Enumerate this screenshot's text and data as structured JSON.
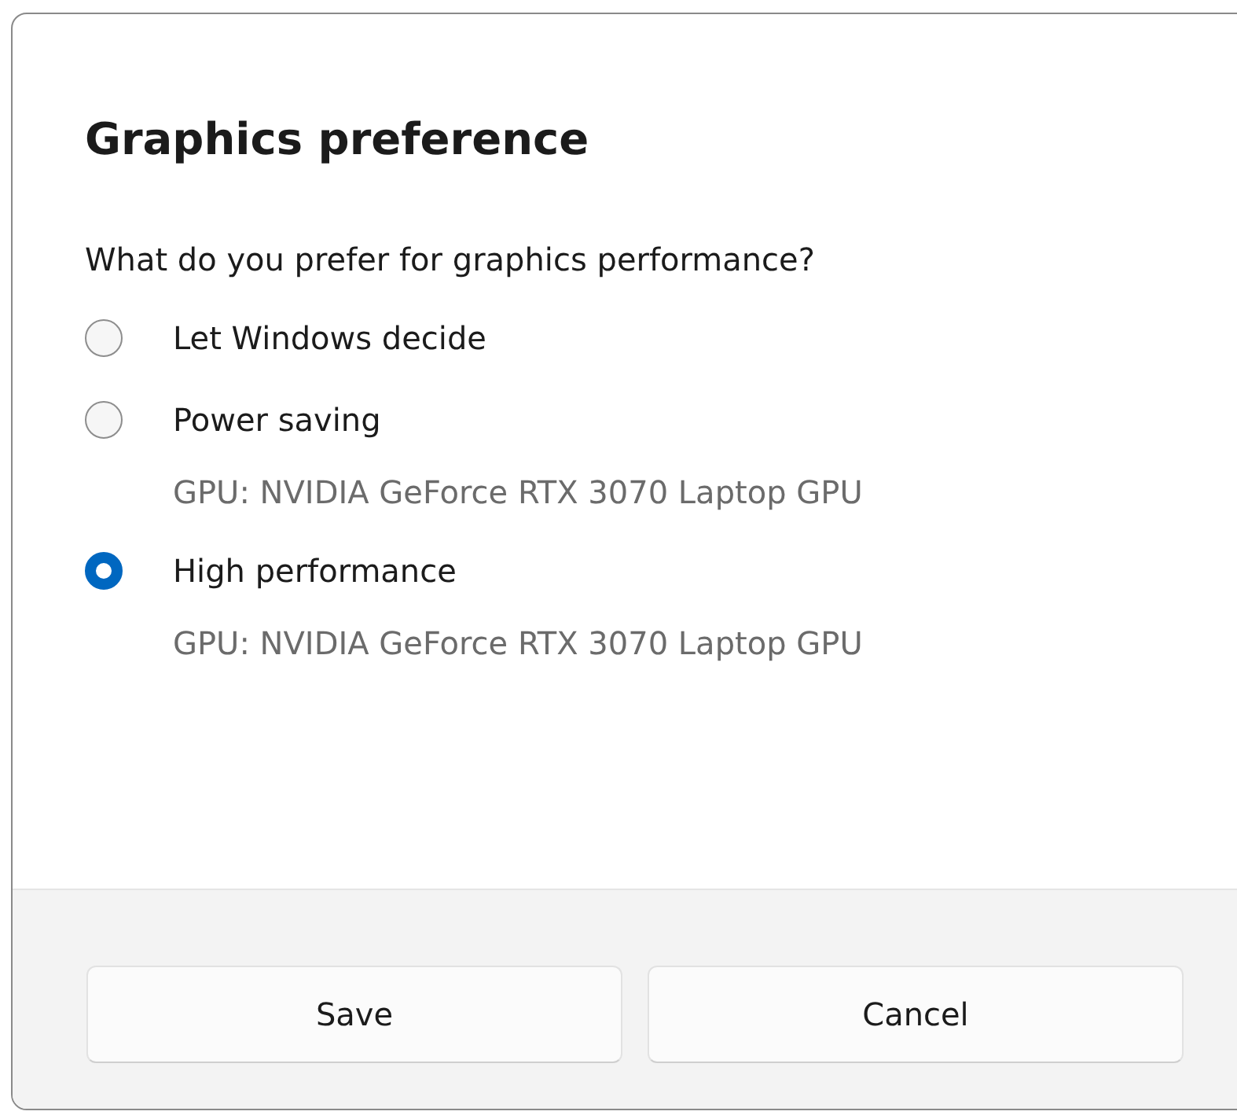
{
  "dialog": {
    "title": "Graphics preference",
    "question": "What do you prefer for graphics performance?",
    "options": [
      {
        "label": "Let Windows decide",
        "selected": false
      },
      {
        "label": "Power saving",
        "detail": "GPU: NVIDIA GeForce RTX 3070 Laptop GPU",
        "selected": false
      },
      {
        "label": "High performance",
        "detail": "GPU: NVIDIA GeForce RTX 3070 Laptop GPU",
        "selected": true
      }
    ],
    "buttons": [
      "Save",
      "Cancel"
    ]
  }
}
